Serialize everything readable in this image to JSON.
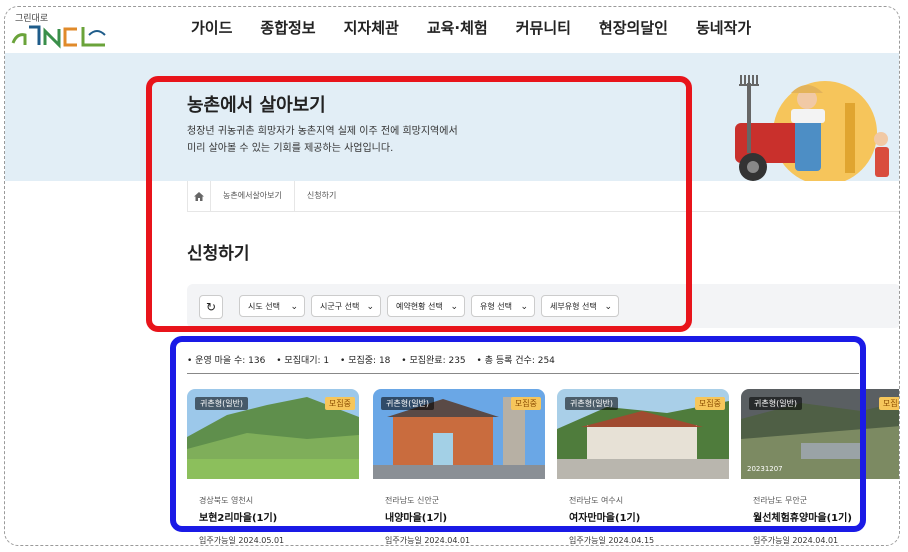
{
  "logo": {
    "small_text": "그린대로",
    "brand": "GNCL"
  },
  "nav": [
    "가이드",
    "종합정보",
    "지자체관",
    "교육·체험",
    "커뮤니티",
    "현장의달인",
    "동네작가"
  ],
  "banner": {
    "title": "농촌에서 살아보기",
    "desc_line1": "청장년 귀농귀촌 희망자가 농촌지역 실제 이주 전에 희망지역에서",
    "desc_line2": "미리 살아볼 수 있는 기회를 제공하는 사업입니다."
  },
  "breadcrumb": [
    "농촌에서살아보기",
    "신청하기"
  ],
  "page_title": "신청하기",
  "filters": [
    "시도 선택",
    "시군구 선택",
    "예약현황 선택",
    "유형 선택",
    "세부유형 선택"
  ],
  "stats": [
    "• 운영 마을 수: 136",
    "• 모집대기: 1",
    "• 모집중: 18",
    "• 모집완료: 235",
    "• 총 등록 건수: 254"
  ],
  "cards": [
    {
      "type": "귀촌형(일반)",
      "status": "모집중",
      "location": "경상북도 영천시",
      "name": "보현2리마을(1기)",
      "date": "입주가능일 2024.05.01"
    },
    {
      "type": "귀촌형(일반)",
      "status": "모집중",
      "location": "전라남도 신안군",
      "name": "내양마을(1기)",
      "date": "입주가능일 2024.04.01"
    },
    {
      "type": "귀촌형(일반)",
      "status": "모집중",
      "location": "전라남도 여수시",
      "name": "여자만마을(1기)",
      "date": "입주가능일 2024.04.15"
    },
    {
      "type": "귀촌형(일반)",
      "status": "모집중",
      "location": "전라남도 무안군",
      "name": "월선체험휴양마을(1기)",
      "date": "입주가능일 2024.04.01",
      "stamp": "20231207"
    }
  ],
  "colors": {
    "highlight_red": "#e8141b",
    "highlight_blue": "#1a1ae6",
    "banner_bg": "#e2eef6",
    "status_badge": "#f6c65b"
  }
}
